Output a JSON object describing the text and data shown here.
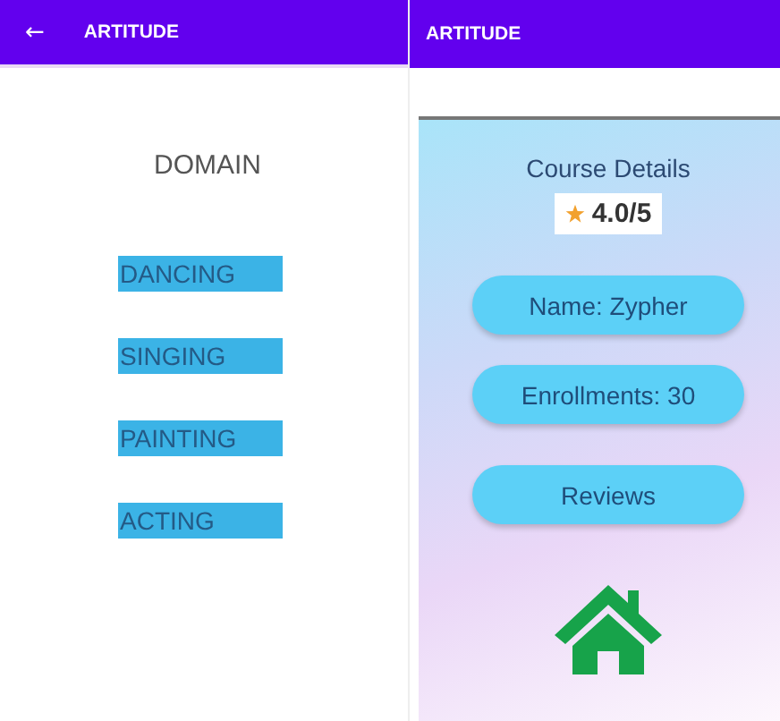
{
  "screens": [
    {
      "app_bar": {
        "back": "←",
        "title": "ARTITUDE"
      },
      "heading": "DOMAIN",
      "domains": [
        "DANCING",
        "SINGING",
        "PAINTING",
        "ACTING"
      ]
    },
    {
      "app_bar": {
        "title": "ARTITUDE"
      },
      "card": {
        "title": "Course Details",
        "rating": "4.0/5",
        "pills": [
          {
            "text": "Name: Zypher",
            "kind": "info"
          },
          {
            "text": "Enrollments: 30",
            "kind": "info"
          },
          {
            "text": "Reviews",
            "kind": "button"
          }
        ]
      }
    }
  ]
}
